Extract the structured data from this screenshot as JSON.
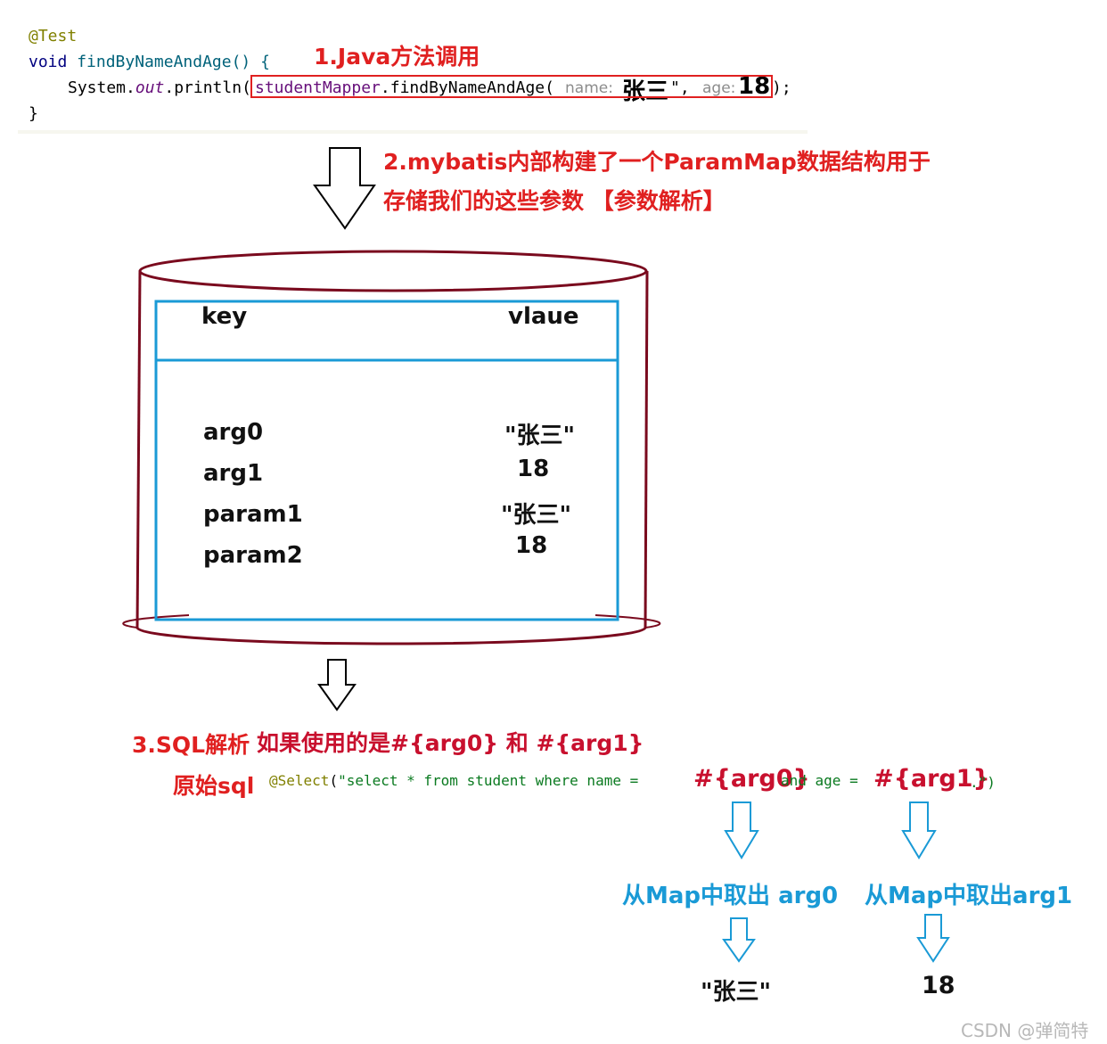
{
  "code": {
    "annotation": "@Test",
    "kw_void": "void",
    "method_sig": "findByNameAndAge() {",
    "sys": "System.",
    "out": "out",
    "println": ".println(",
    "call_obj": "studentMapper",
    "call_method": ".findByNameAndAge(",
    "hint_name": "name:",
    "val_name": "张三",
    "quote_comma": "\",",
    "hint_age": "age:",
    "val_age": "18",
    "close": ");",
    "brace": "}"
  },
  "step1": "1.Java方法调用",
  "step2_line1": "2.mybatis内部构建了一个ParamMap数据结构用于",
  "step2_line2": "存储我们的这些参数 【参数解析】",
  "table": {
    "header_key": "key",
    "header_value": "vlaue",
    "rows": [
      {
        "key": "arg0",
        "value": "\"张三\""
      },
      {
        "key": "arg1",
        "value": "18"
      },
      {
        "key": "param1",
        "value": "\"张三\""
      },
      {
        "key": "param2",
        "value": "18"
      }
    ]
  },
  "step3": "3.SQL解析",
  "step3_desc": "如果使用的是#{arg0}  和  #{arg1}",
  "raw_sql_label": "原始sql",
  "sql": {
    "prefix_anno": "@Select",
    "open": "(",
    "part1": "\"select * from student where name =",
    "p1": "#{arg0}",
    "part2": "and age = ",
    "p2": "#{arg1}",
    "end": ".\")"
  },
  "fetch1": "从Map中取出 arg0",
  "fetch2": "从Map中取出arg1",
  "result1": "\"张三\"",
  "result2": "18",
  "watermark": "CSDN @弹简特",
  "colors": {
    "accent_red": "#e02020",
    "cylinder": "#7a0a1e",
    "table_border": "#1a9ad6",
    "blue_text": "#1a9ad6"
  }
}
